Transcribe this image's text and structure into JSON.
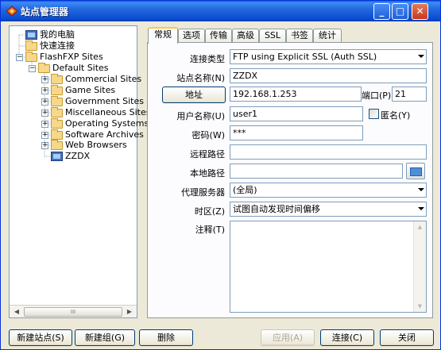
{
  "window": {
    "title": "站点管理器"
  },
  "title_buttons": {
    "minimize": "_",
    "maximize": "□",
    "close": "✕"
  },
  "tree": {
    "items": [
      {
        "label": "我的电脑"
      },
      {
        "label": "快速连接"
      },
      {
        "label": "FlashFXP Sites"
      },
      {
        "label": "Default Sites"
      },
      {
        "label": "Commercial Sites"
      },
      {
        "label": "Game Sites"
      },
      {
        "label": "Government Sites"
      },
      {
        "label": "Miscellaneous Sites"
      },
      {
        "label": "Operating Systems"
      },
      {
        "label": "Software Archives"
      },
      {
        "label": "Web Browsers"
      },
      {
        "label": "ZZDX"
      }
    ],
    "scroll_thumb": "III"
  },
  "tabs": [
    "常规",
    "选项",
    "传输",
    "高级",
    "SSL",
    "书签",
    "统计"
  ],
  "form": {
    "connection_type_label": "连接类型",
    "connection_type_value": "FTP using Explicit SSL (Auth SSL)",
    "site_name_label": "站点名称(N)",
    "site_name_value": "ZZDX",
    "address_button": "地址",
    "address_value": "192.168.1.253",
    "port_label": "端口(P)",
    "port_value": "21",
    "username_label": "用户名称(U)",
    "username_value": "user1",
    "anonymous_label": "匿名(Y)",
    "password_label": "密码(W)",
    "password_value": "***",
    "remote_path_label": "远程路径",
    "remote_path_value": "",
    "local_path_label": "本地路径",
    "local_path_value": "",
    "proxy_label": "代理服务器",
    "proxy_value": "(全局)",
    "timezone_label": "时区(Z)",
    "timezone_value": "试图自动发现时间偏移",
    "notes_label": "注释(T)",
    "notes_value": ""
  },
  "buttons": {
    "new_site": "新建站点(S)",
    "new_group": "新建组(G)",
    "delete": "删除",
    "apply": "应用(A)",
    "connect": "连接(C)",
    "close": "关闭"
  }
}
